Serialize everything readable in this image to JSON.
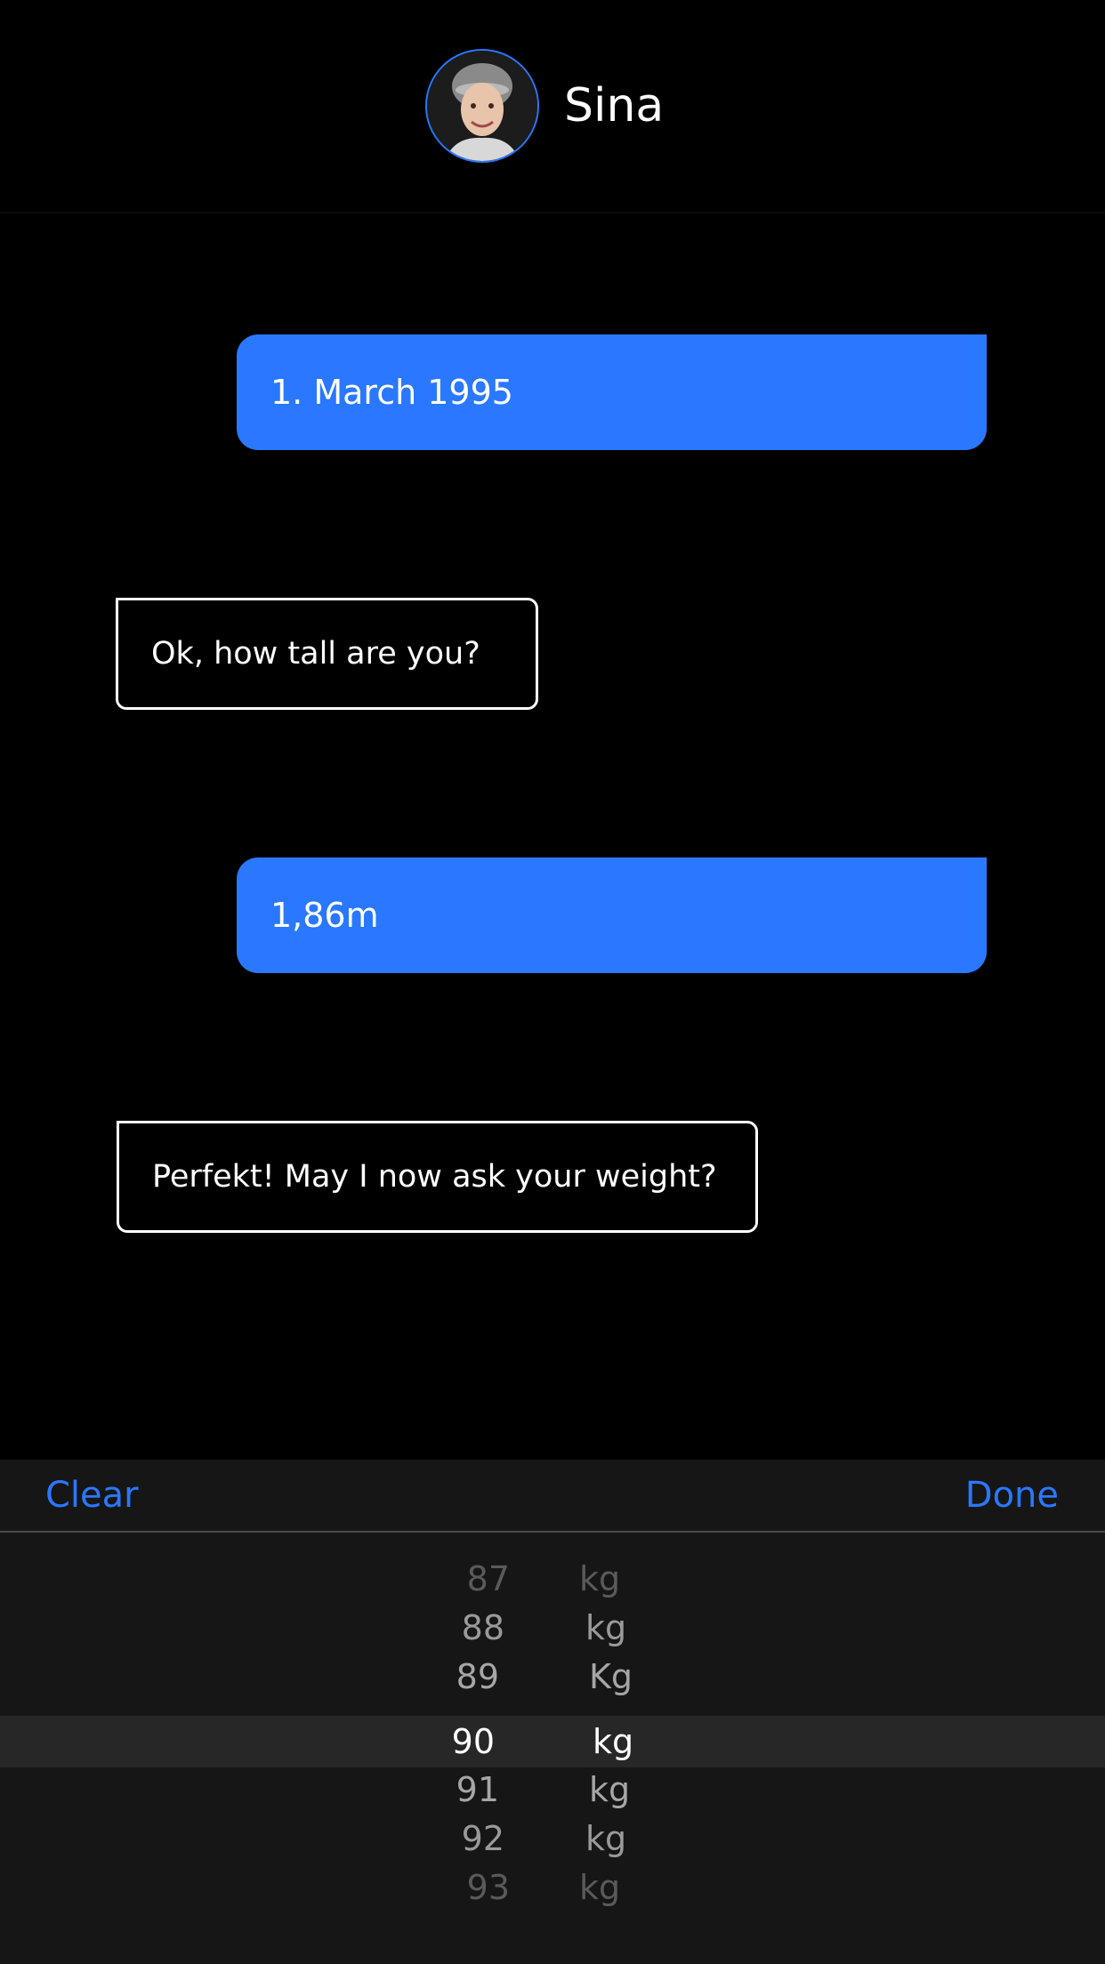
{
  "header": {
    "contact_name": "Sina",
    "avatar_icon": "person-avatar-icon"
  },
  "messages": [
    {
      "direction": "outgoing",
      "text": "1. March 1995"
    },
    {
      "direction": "incoming",
      "text": "Ok, how tall are you?"
    },
    {
      "direction": "outgoing",
      "text": "1,86m"
    },
    {
      "direction": "incoming",
      "text": "Perfekt! May I now ask your weight?"
    }
  ],
  "toolbar": {
    "clear_label": "Clear",
    "done_label": "Done"
  },
  "picker": {
    "rows": [
      {
        "value": "87",
        "unit": "kg"
      },
      {
        "value": "88",
        "unit": "kg"
      },
      {
        "value": "89",
        "unit": "Kg"
      },
      {
        "value": "90",
        "unit": "kg"
      },
      {
        "value": "91",
        "unit": "kg"
      },
      {
        "value": "92",
        "unit": "kg"
      },
      {
        "value": "93",
        "unit": "kg"
      }
    ],
    "selected_value": "90"
  },
  "colors": {
    "accent": "#2a78ff",
    "background": "#000000",
    "panel": "#161616",
    "selection": "#272727"
  }
}
